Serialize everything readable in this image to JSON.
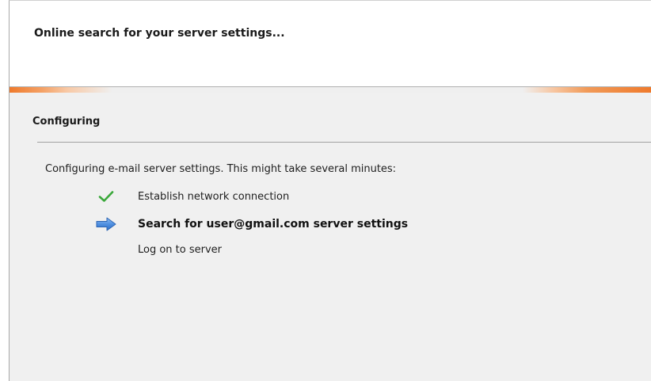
{
  "header": {
    "title": "Online search for your server settings..."
  },
  "section": {
    "title": "Configuring",
    "intro": "Configuring e-mail server settings. This might take several minutes:"
  },
  "steps": [
    {
      "label": "Establish network connection",
      "status": "done",
      "icon": "checkmark-icon"
    },
    {
      "label": "Search for user@gmail.com server settings",
      "status": "in-progress",
      "icon": "arrow-right-icon"
    },
    {
      "label": "Log on to server",
      "status": "pending",
      "icon": ""
    }
  ],
  "colors": {
    "header_bg": "#ffffff",
    "body_bg": "#f0f0f0",
    "progress_accent": "#ef7a2c",
    "check_green": "#3aa83a",
    "arrow_blue": "#3d7fd6"
  }
}
